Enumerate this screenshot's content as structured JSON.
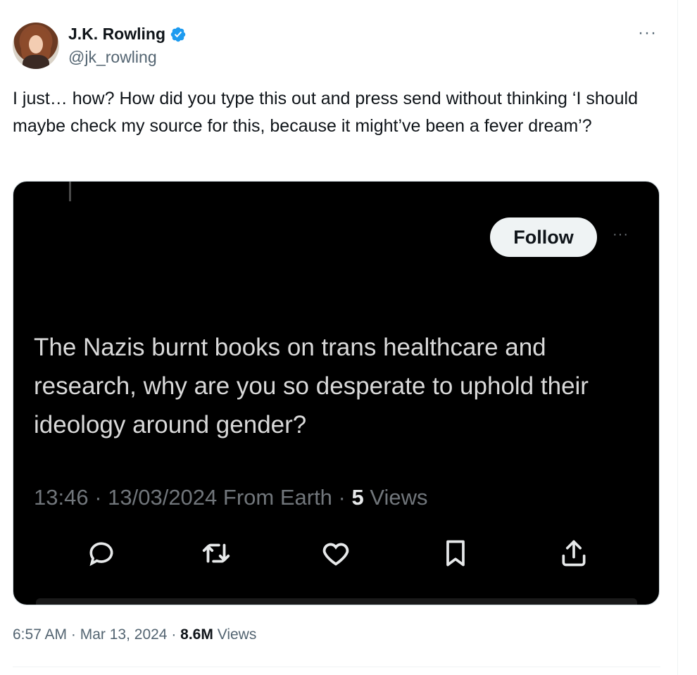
{
  "author": {
    "name": "J.K. Rowling",
    "handle": "@jk_rowling",
    "verified": true
  },
  "tweet": {
    "text": "I just… how? How did you type this out and press send without thinking ‘I should maybe check my source for this, because it might’ve been a fever dream’?"
  },
  "quoted_screenshot": {
    "follow_label": "Follow",
    "text": "The Nazis burnt books on trans healthcare and research, why are you so desperate to uphold their ideology around gender?",
    "meta_prefix": "13:46 · 13/03/2024 From Earth · ",
    "views_count": "5",
    "views_label": "Views",
    "actions": [
      "reply-icon",
      "retweet-icon",
      "like-icon",
      "bookmark-icon",
      "share-icon"
    ]
  },
  "footer": {
    "time": "6:57 AM",
    "sep1": " · ",
    "date": "Mar 13, 2024",
    "sep2": " · ",
    "views_count": "8.6M",
    "views_label": "Views"
  },
  "colors": {
    "verified_blue": "#1d9bf0",
    "secondary_text": "#536471",
    "media_background": "#000000"
  }
}
